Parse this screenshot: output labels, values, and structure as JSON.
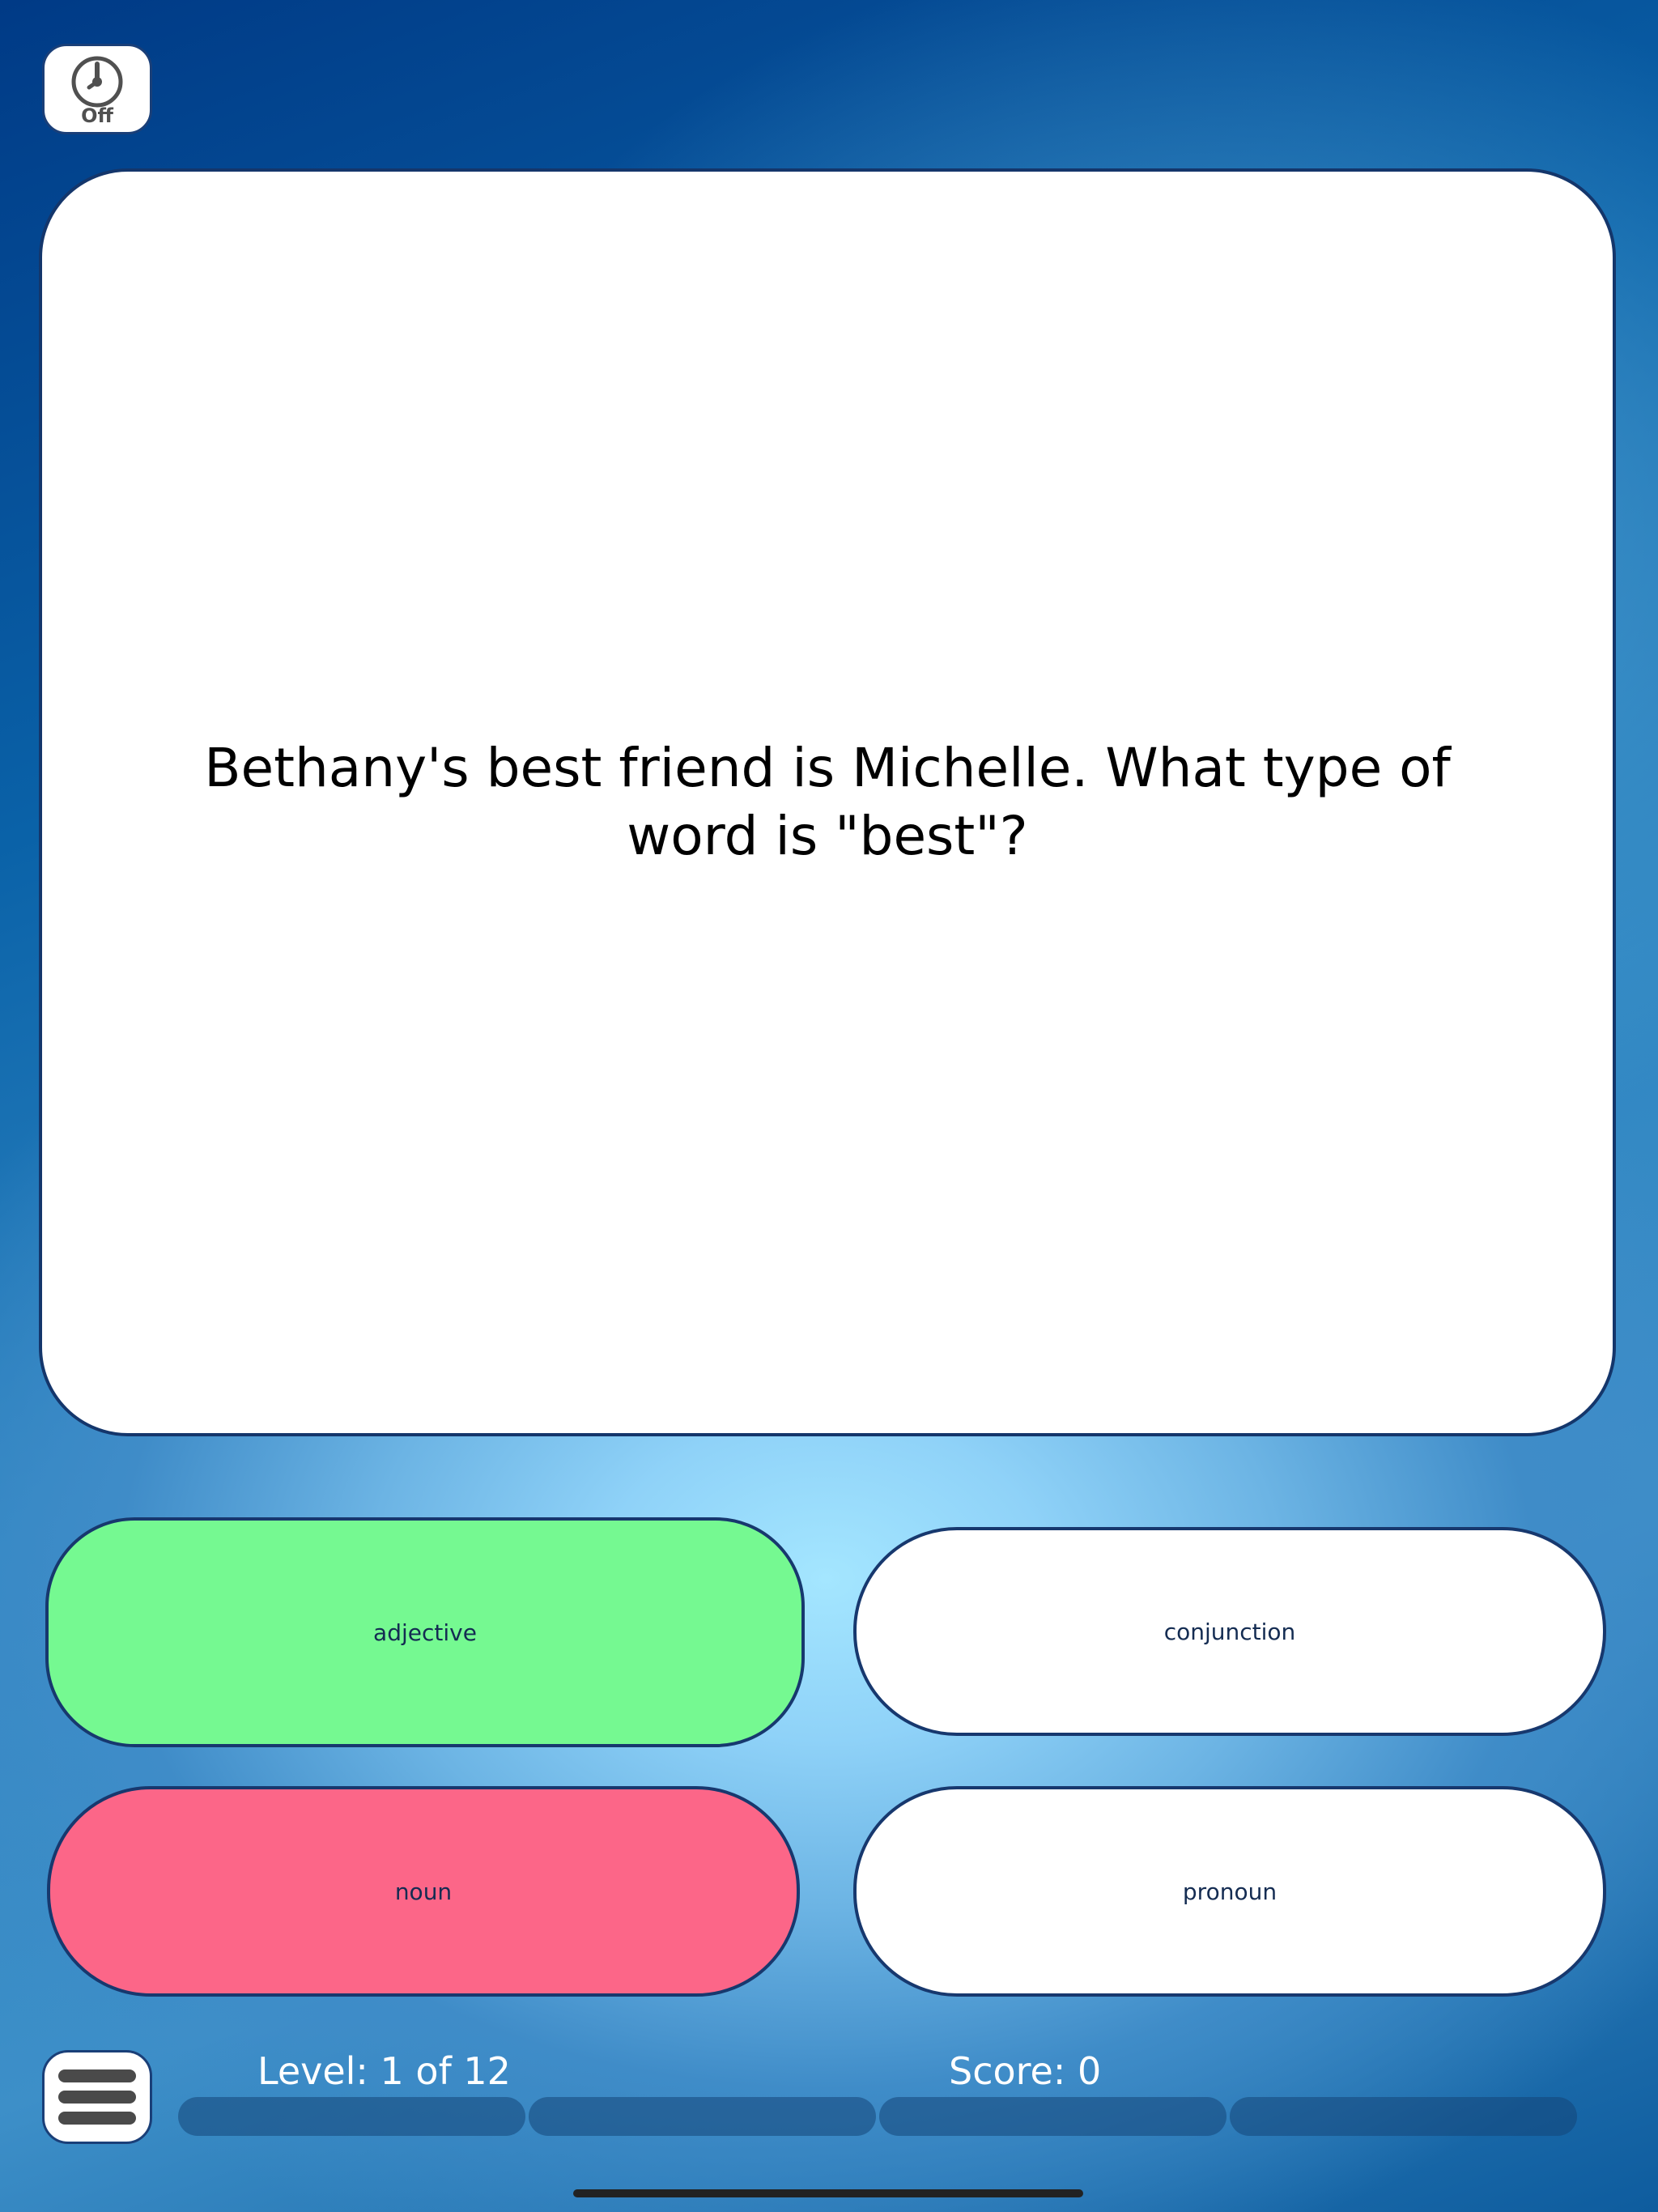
{
  "timer": {
    "label": "Off",
    "icon": "clock-icon"
  },
  "question": {
    "text": "Bethany's best friend is Michelle. What type of word is \"best\"?"
  },
  "answers": [
    {
      "label": "adjective",
      "state": "correct",
      "color": "#75f991"
    },
    {
      "label": "conjunction",
      "state": "neutral",
      "color": "#ffffff"
    },
    {
      "label": "noun",
      "state": "incorrect",
      "color": "#fc6688"
    },
    {
      "label": "pronoun",
      "state": "neutral",
      "color": "#ffffff"
    }
  ],
  "footer": {
    "menu_icon": "hamburger-menu-icon",
    "level_text": "Level: 1 of 12",
    "score_text": "Score: 0",
    "progress_segments": 4
  }
}
